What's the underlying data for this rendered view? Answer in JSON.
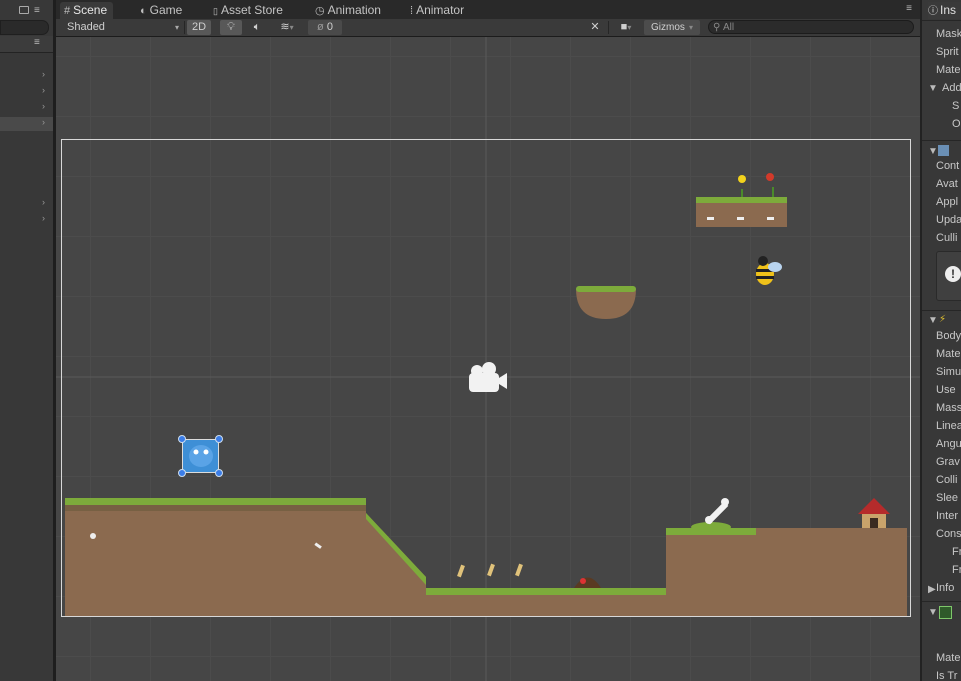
{
  "hierarchy": {
    "menu_icon": "≡",
    "arrows": [
      "›",
      "›",
      "›",
      "›",
      "›",
      "›"
    ]
  },
  "tabs": [
    {
      "label": "Scene",
      "icon": "#"
    },
    {
      "label": "Game",
      "icon": "◐"
    },
    {
      "label": "Asset Store",
      "icon": "🔒"
    },
    {
      "label": "Animation",
      "icon": "◷"
    },
    {
      "label": "Animator",
      "icon": "⁞"
    }
  ],
  "toolbar": {
    "shading_mode": "Shaded",
    "mode_2d": "2D",
    "hidden_count": "0",
    "gizmos": "Gizmos",
    "search_placeholder": "All"
  },
  "inspector": {
    "tab_label": "Ins",
    "rows": [
      {
        "text": "Mask"
      },
      {
        "text": "Sprit"
      },
      {
        "text": "Mate"
      },
      {
        "text": "Add"
      },
      {
        "text": "S"
      },
      {
        "text": "O"
      },
      {
        "text": "Cont"
      },
      {
        "text": "Avat"
      },
      {
        "text": "Appl"
      },
      {
        "text": "Upda"
      },
      {
        "text": "Culli"
      },
      {
        "text": "Body"
      },
      {
        "text": "Mate"
      },
      {
        "text": "Simu"
      },
      {
        "text": "Use"
      },
      {
        "text": "Mass"
      },
      {
        "text": "Linea"
      },
      {
        "text": "Angu"
      },
      {
        "text": "Grav"
      },
      {
        "text": "Colli"
      },
      {
        "text": "Slee"
      },
      {
        "text": "Inter"
      },
      {
        "text": "Cons"
      },
      {
        "text": "Fr"
      },
      {
        "text": "Fr"
      },
      {
        "text": "Info"
      },
      {
        "text": "Mate"
      },
      {
        "text": "Is Tr"
      }
    ]
  },
  "colors": {
    "scene_bg": "#464646",
    "grass": "#7dab3b",
    "dirt": "#8b6a4f",
    "selection": "#3b7de8"
  }
}
